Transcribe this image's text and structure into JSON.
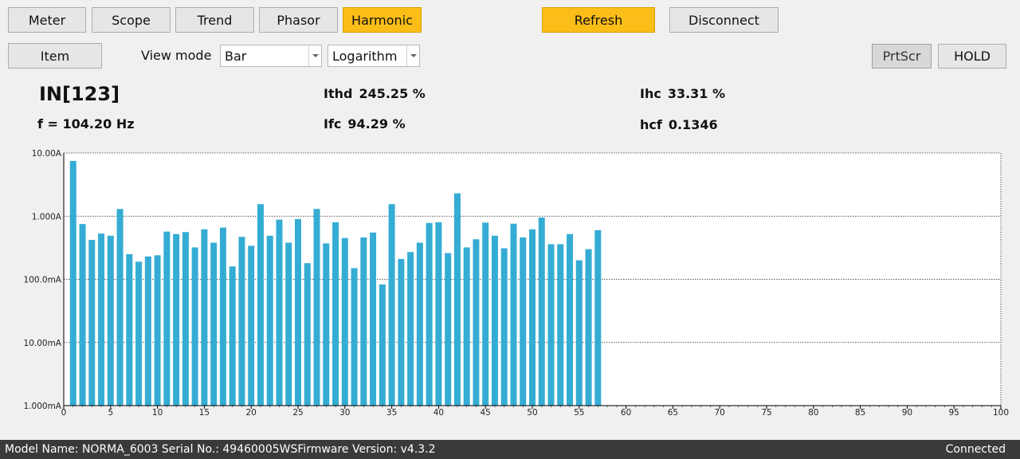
{
  "tabs": [
    {
      "label": "Meter"
    },
    {
      "label": "Scope"
    },
    {
      "label": "Trend"
    },
    {
      "label": "Phasor"
    },
    {
      "label": "Harmonic",
      "active": true
    }
  ],
  "toolbar": {
    "refresh_label": "Refresh",
    "disconnect_label": "Disconnect",
    "item_label": "Item",
    "view_mode_label": "View mode",
    "view_mode_value": "Bar",
    "scale_value": "Logarithm",
    "prtscr_label": "PrtScr",
    "hold_label": "HOLD"
  },
  "measurements": {
    "channel": "IN[123]",
    "frequency": "f = 104.20 Hz",
    "ithd": {
      "label": "Ithd",
      "value": "245.25 %"
    },
    "ifc": {
      "label": "Ifc",
      "value": "94.29 %"
    },
    "ihc": {
      "label": "Ihc",
      "value": "33.31 %"
    },
    "hcf": {
      "label": "hcf",
      "value": "0.1346"
    }
  },
  "chart_data": {
    "type": "bar",
    "scale": "log",
    "bar_color": "#35acd4",
    "ylim": [
      0.001,
      10
    ],
    "y_ticks": [
      "1.000mA",
      "10.00mA",
      "100.0mA",
      "1.000A",
      "10.00A"
    ],
    "x_ticks": [
      "0",
      "5",
      "10",
      "15",
      "20",
      "25",
      "30",
      "35",
      "40",
      "45",
      "50",
      "55",
      "60",
      "65",
      "70",
      "75",
      "80",
      "85",
      "90",
      "95",
      "100"
    ],
    "xlim": [
      0,
      100
    ],
    "grid": true,
    "x": [
      1,
      2,
      3,
      4,
      5,
      6,
      7,
      8,
      9,
      10,
      11,
      12,
      13,
      14,
      15,
      16,
      17,
      18,
      19,
      20,
      21,
      22,
      23,
      24,
      25,
      26,
      27,
      28,
      29,
      30,
      31,
      32,
      33,
      34,
      35,
      36,
      37,
      38,
      39,
      40,
      41,
      42,
      43,
      44,
      45,
      46,
      47,
      48,
      49,
      50,
      51,
      52,
      53,
      54,
      55,
      56,
      57
    ],
    "values": [
      7.5,
      0.75,
      0.42,
      0.53,
      0.49,
      1.3,
      0.25,
      0.19,
      0.23,
      0.24,
      0.57,
      0.52,
      0.56,
      0.32,
      0.62,
      0.38,
      0.66,
      0.16,
      0.47,
      0.34,
      1.55,
      0.49,
      0.88,
      0.38,
      0.9,
      0.18,
      1.3,
      0.37,
      0.8,
      0.45,
      0.15,
      0.46,
      0.55,
      0.083,
      1.55,
      0.21,
      0.27,
      0.38,
      0.78,
      0.8,
      0.26,
      2.3,
      0.32,
      0.43,
      0.79,
      0.49,
      0.31,
      0.76,
      0.46,
      0.62,
      0.95,
      0.36,
      0.36,
      0.52,
      0.2,
      0.3,
      0.6
    ]
  },
  "status_bar": {
    "info": "Model Name:  NORMA_6003 Serial No.:  49460005WSFirmware Version:  v4.3.2",
    "connection": "Connected"
  }
}
